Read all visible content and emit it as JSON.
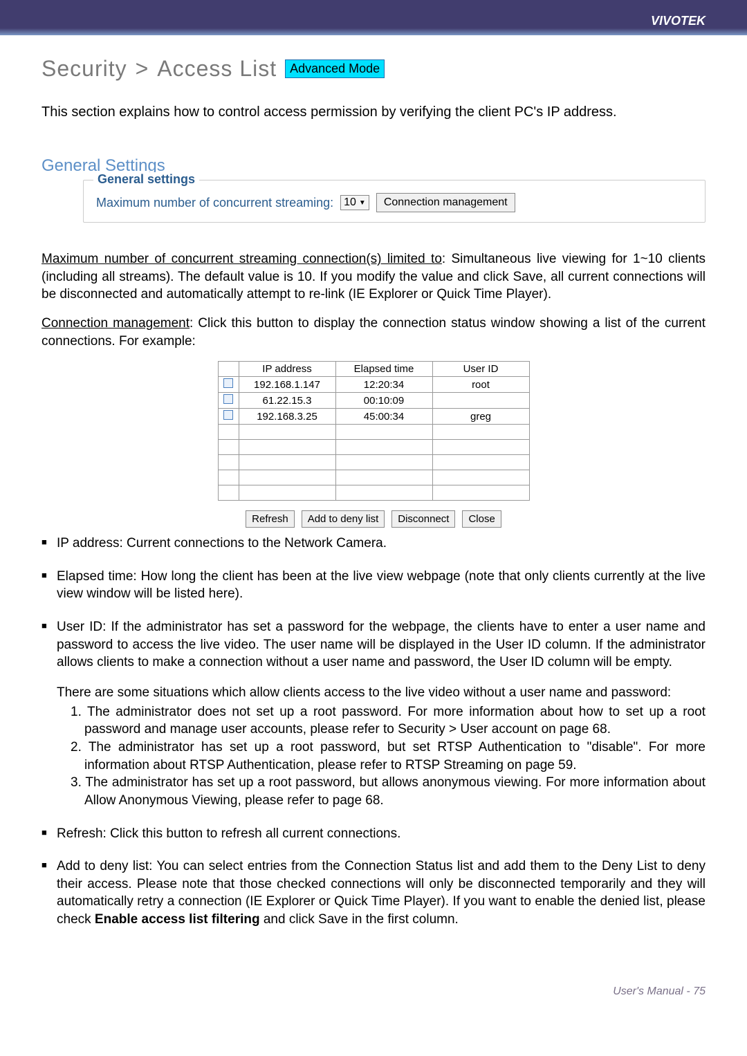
{
  "header": {
    "brand": "VIVOTEK"
  },
  "breadcrumb": {
    "security": "Security",
    "gt": ">",
    "access_list": "Access List",
    "badge": "Advanced Mode"
  },
  "intro": "This section explains how to control access permission by verifying the client PC's IP address.",
  "general_settings": {
    "heading": "General Settings",
    "legend": "General settings",
    "max_label": "Maximum number of concurrent streaming:",
    "max_value": "10",
    "conn_mgmt_btn": "Connection management"
  },
  "para_max": {
    "lead_u": "Maximum number of concurrent streaming connection(s) limited to",
    "rest": ": Simultaneous live viewing for 1~10 clients (including all streams). The default value is 10. If you modify the value and click Save, all current connections will be disconnected and automatically attempt to re-link (IE Explorer or Quick Time Player)."
  },
  "para_conn": {
    "lead_u": "Connection management",
    "rest": ": Click this button to display the connection status window showing a list of the current connections. For example:"
  },
  "conn_table": {
    "headers": {
      "ip": "IP address",
      "elapsed": "Elapsed time",
      "user": "User ID"
    },
    "rows": [
      {
        "ip": "192.168.1.147",
        "elapsed": "12:20:34",
        "user": "root"
      },
      {
        "ip": "61.22.15.3",
        "elapsed": "00:10:09",
        "user": ""
      },
      {
        "ip": "192.168.3.25",
        "elapsed": "45:00:34",
        "user": "greg"
      }
    ],
    "empty_rows": 5,
    "buttons": {
      "refresh": "Refresh",
      "add_deny": "Add to deny list",
      "disconnect": "Disconnect",
      "close": "Close"
    }
  },
  "bullets": {
    "ip": "IP address: Current connections to the Network Camera.",
    "elapsed": "Elapsed time: How long the client has been at the live view webpage (note that only clients currently at the live view window will be listed here).",
    "userid_main": "User ID: If the administrator has set a password for the webpage, the clients have to enter a user name and password to access the live video. The user name will be displayed in the User ID column. If  the administrator allows clients to make a connection without a user name and password, the User ID column will be empty.",
    "userid_situations_intro": "There are some situations which allow clients access to the live video without a user name and password:",
    "sit1": "1. The administrator does not set up a root password. For more information about how to set up a root password and manage user accounts, please refer to Security > User account on page 68.",
    "sit2_a": "2. The administrator has set up a root password, but set ",
    "sit2_term": "RTSP Authentication",
    "sit2_b": " to \"disable\". For more information about RTSP Authentication, please refer to RTSP Streaming on page 59.",
    "sit3_a": "3. The administrator has set up a root password, but allows anonymous viewing. For more information about ",
    "sit3_term": "Allow Anonymous Viewing",
    "sit3_b": ", please refer to page 68.",
    "refresh": "Refresh: Click this button to refresh all current connections.",
    "add_deny_a": "Add to deny list: You can select entries from the Connection Status list and add them to the Deny List to deny their access. Please note that those checked connections will only be disconnected temporarily and they will automatically retry a connection (IE Explorer or Quick Time Player). If you want to enable the denied list, please check ",
    "add_deny_bold": "Enable access list filtering",
    "add_deny_b": " and click Save in the first column."
  },
  "footer": {
    "text": "User's Manual - 75"
  }
}
